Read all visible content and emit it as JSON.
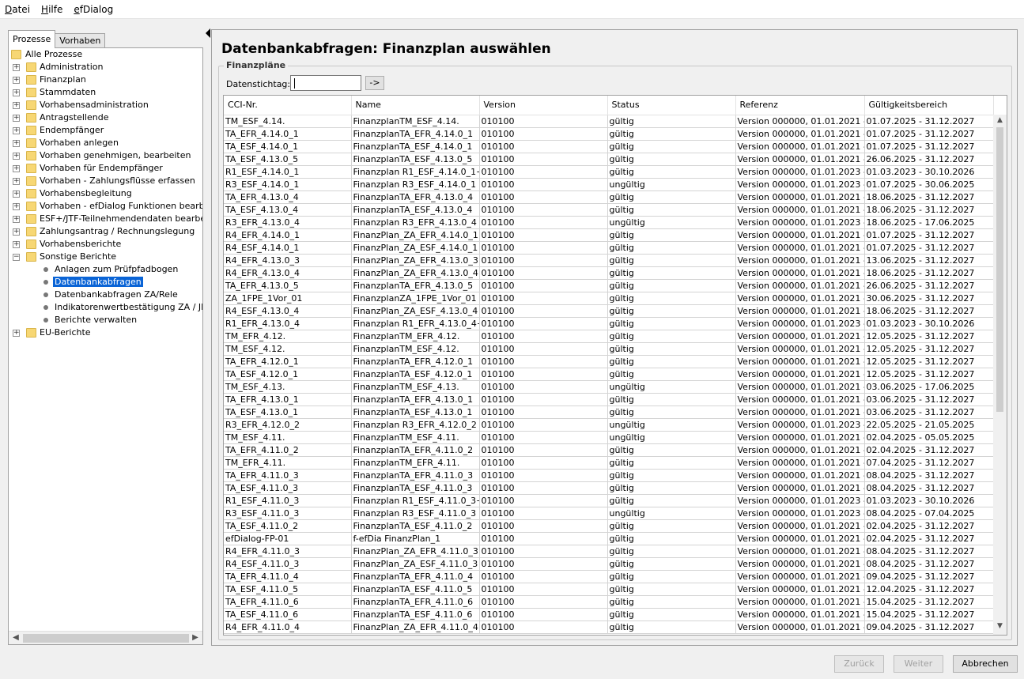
{
  "menu": [
    "Datei",
    "Hilfe",
    "efDialog"
  ],
  "left_tabs": [
    "Prozesse",
    "Vorhaben"
  ],
  "tree": {
    "root": "Alle Prozesse",
    "items": [
      "Administration",
      "Finanzplan",
      "Stammdaten",
      "Vorhabensadministration",
      "Antragstellende",
      "Endempfänger",
      "Vorhaben anlegen",
      "Vorhaben genehmigen, bearbeiten",
      "Vorhaben für Endempfänger",
      "Vorhaben - Zahlungsflüsse erfassen",
      "Vorhabensbegleitung",
      "Vorhaben - efDialog Funktionen bearbeiten",
      "ESF+/JTF-Teilnehmendendaten bearbeiten",
      "Zahlungsantrag / Rechnungslegung",
      "Vorhabensberichte",
      "Sonstige Berichte"
    ],
    "sub_items": [
      "Anlagen zum Prüfpfadbogen",
      "Datenbankabfragen",
      "Datenbankabfragen ZA/Rele",
      "Indikatorenwertbestätigung ZA / JDB",
      "Berichte verwalten"
    ],
    "selected": "Datenbankabfragen",
    "last": "EU-Berichte"
  },
  "main": {
    "title": "Datenbankabfragen: Finanzplan auswählen",
    "group_label": "Finanzpläne",
    "stichtag_label": "Datenstichtag:",
    "stichtag_value": "",
    "go_label": "->",
    "columns": [
      "CCI-Nr.",
      "Name",
      "Version",
      "Status",
      "Referenz",
      "Gültigkeitsbereich"
    ],
    "rows": [
      [
        "TM_ESF_4.14.",
        "FinanzplanTM_ESF_4.14.",
        "010100",
        "gültig",
        "Version 000000,  01.01.2021 -...",
        "01.07.2025 - 31.12.2027"
      ],
      [
        "TA_EFR_4.14.0_1",
        "FinanzplanTA_EFR_4.14.0_1",
        "010100",
        "gültig",
        "Version 000000,  01.01.2021 -...",
        "01.07.2025 - 31.12.2027"
      ],
      [
        "TA_ESF_4.14.0_1",
        "FinanzplanTA_ESF_4.14.0_1",
        "010100",
        "gültig",
        "Version 000000,  01.01.2021 -...",
        "01.07.2025 - 31.12.2027"
      ],
      [
        "TA_ESF_4.13.0_5",
        "FinanzplanTA_ESF_4.13.0_5",
        "010100",
        "gültig",
        "Version 000000,  01.01.2021 -...",
        "26.06.2025 - 31.12.2027"
      ],
      [
        "R1_ESF_4.14.0_1",
        "Finanzplan R1_ESF_4.14.0_1+",
        "010100",
        "gültig",
        "Version 000000,  01.01.2023 -...",
        "01.03.2023 - 30.10.2026"
      ],
      [
        "R3_ESF_4.14.0_1",
        "Finanzplan R3_ESF_4.14.0_1",
        "010100",
        "ungültig",
        "Version 000000,  01.01.2023 -...",
        "01.07.2025 - 30.06.2025"
      ],
      [
        "TA_EFR_4.13.0_4",
        "FinanzplanTA_EFR_4.13.0_4",
        "010100",
        "gültig",
        "Version 000000,  01.01.2021 -...",
        "18.06.2025 - 31.12.2027"
      ],
      [
        "TA_ESF_4.13.0_4",
        "FinanzplanTA_ESF_4.13.0_4",
        "010100",
        "gültig",
        "Version 000000,  01.01.2021 -...",
        "18.06.2025 - 31.12.2027"
      ],
      [
        "R3_EFR_4.13.0_4",
        "Finanzplan R3_EFR_4.13.0_4",
        "010100",
        "ungültig",
        "Version 000000,  01.01.2023 -...",
        "18.06.2025 - 17.06.2025"
      ],
      [
        "R4_EFR_4.14.0_1",
        "FinanzPlan_ZA_EFR_4.14.0_1",
        "010100",
        "gültig",
        "Version 000000,  01.01.2021 -...",
        "01.07.2025 - 31.12.2027"
      ],
      [
        "R4_ESF_4.14.0_1",
        "FinanzPlan_ZA_ESF_4.14.0_1",
        "010100",
        "gültig",
        "Version 000000,  01.01.2021 -...",
        "01.07.2025 - 31.12.2027"
      ],
      [
        "R4_EFR_4.13.0_3",
        "FinanzPlan_ZA_EFR_4.13.0_3",
        "010100",
        "gültig",
        "Version 000000,  01.01.2021 -...",
        "13.06.2025 - 31.12.2027"
      ],
      [
        "R4_EFR_4.13.0_4",
        "FinanzPlan_ZA_EFR_4.13.0_4",
        "010100",
        "gültig",
        "Version 000000,  01.01.2021 -...",
        "18.06.2025 - 31.12.2027"
      ],
      [
        "TA_EFR_4.13.0_5",
        "FinanzplanTA_EFR_4.13.0_5",
        "010100",
        "gültig",
        "Version 000000,  01.01.2021 -...",
        "26.06.2025 - 31.12.2027"
      ],
      [
        "ZA_1FPE_1Vor_01",
        "FinanzplanZA_1FPE_1Vor_01",
        "010100",
        "gültig",
        "Version 000000,  01.01.2021 -...",
        "30.06.2025 - 31.12.2027"
      ],
      [
        "R4_ESF_4.13.0_4",
        "FinanzPlan_ZA_ESF_4.13.0_4",
        "010100",
        "gültig",
        "Version 000000,  01.01.2021 -...",
        "18.06.2025 - 31.12.2027"
      ],
      [
        "R1_EFR_4.13.0_4",
        "Finanzplan R1_EFR_4.13.0_4+",
        "010100",
        "gültig",
        "Version 000000,  01.01.2023 -...",
        "01.03.2023 - 30.10.2026"
      ],
      [
        "TM_EFR_4.12.",
        "FinanzplanTM_EFR_4.12.",
        "010100",
        "gültig",
        "Version 000000,  01.01.2021 -...",
        "12.05.2025 - 31.12.2027"
      ],
      [
        "TM_ESF_4.12.",
        "FinanzplanTM_ESF_4.12.",
        "010100",
        "gültig",
        "Version 000000,  01.01.2021 -...",
        "12.05.2025 - 31.12.2027"
      ],
      [
        "TA_EFR_4.12.0_1",
        "FinanzplanTA_EFR_4.12.0_1",
        "010100",
        "gültig",
        "Version 000000,  01.01.2021 -...",
        "12.05.2025 - 31.12.2027"
      ],
      [
        "TA_ESF_4.12.0_1",
        "FinanzplanTA_ESF_4.12.0_1",
        "010100",
        "gültig",
        "Version 000000,  01.01.2021 -...",
        "12.05.2025 - 31.12.2027"
      ],
      [
        "TM_ESF_4.13.",
        "FinanzplanTM_ESF_4.13.",
        "010100",
        "ungültig",
        "Version 000000,  01.01.2021 -...",
        "03.06.2025 - 17.06.2025"
      ],
      [
        "TA_EFR_4.13.0_1",
        "FinanzplanTA_EFR_4.13.0_1",
        "010100",
        "gültig",
        "Version 000000,  01.01.2021 -...",
        "03.06.2025 - 31.12.2027"
      ],
      [
        "TA_ESF_4.13.0_1",
        "FinanzplanTA_ESF_4.13.0_1",
        "010100",
        "gültig",
        "Version 000000,  01.01.2021 -...",
        "03.06.2025 - 31.12.2027"
      ],
      [
        "R3_EFR_4.12.0_2",
        "Finanzplan R3_EFR_4.12.0_2",
        "010100",
        "ungültig",
        "Version 000000,  01.01.2023 -...",
        "22.05.2025 - 21.05.2025"
      ],
      [
        "TM_ESF_4.11.",
        "FinanzplanTM_ESF_4.11.",
        "010100",
        "ungültig",
        "Version 000000,  01.01.2021 -...",
        "02.04.2025 - 05.05.2025"
      ],
      [
        "TA_EFR_4.11.0_2",
        "FinanzplanTA_EFR_4.11.0_2",
        "010100",
        "gültig",
        "Version 000000,  01.01.2021 -...",
        "02.04.2025 - 31.12.2027"
      ],
      [
        "TM_EFR_4.11.",
        "FinanzplanTM_EFR_4.11.",
        "010100",
        "gültig",
        "Version 000000,  01.01.2021 -...",
        "07.04.2025 - 31.12.2027"
      ],
      [
        "TA_EFR_4.11.0_3",
        "FinanzplanTA_EFR_4.11.0_3",
        "010100",
        "gültig",
        "Version 000000,  01.01.2021 -...",
        "08.04.2025 - 31.12.2027"
      ],
      [
        "TA_ESF_4.11.0_3",
        "FinanzplanTA_ESF_4.11.0_3",
        "010100",
        "gültig",
        "Version 000000,  01.01.2021 -...",
        "08.04.2025 - 31.12.2027"
      ],
      [
        "R1_ESF_4.11.0_3",
        "Finanzplan R1_ESF_4.11.0_3+",
        "010100",
        "gültig",
        "Version 000000,  01.01.2023 -...",
        "01.03.2023 - 30.10.2026"
      ],
      [
        "R3_ESF_4.11.0_3",
        "Finanzplan R3_ESF_4.11.0_3",
        "010100",
        "ungültig",
        "Version 000000,  01.01.2023 -...",
        "08.04.2025 - 07.04.2025"
      ],
      [
        "TA_ESF_4.11.0_2",
        "FinanzplanTA_ESF_4.11.0_2",
        "010100",
        "gültig",
        "Version 000000,  01.01.2021 -...",
        "02.04.2025 - 31.12.2027"
      ],
      [
        "efDialog-FP-01",
        "f-efDia FinanzPlan_1",
        "010100",
        "gültig",
        "Version 000000,  01.01.2021 -...",
        "02.04.2025 - 31.12.2027"
      ],
      [
        "R4_EFR_4.11.0_3",
        "FinanzPlan_ZA_EFR_4.11.0_3",
        "010100",
        "gültig",
        "Version 000000,  01.01.2021 -...",
        "08.04.2025 - 31.12.2027"
      ],
      [
        "R4_ESF_4.11.0_3",
        "FinanzPlan_ZA_ESF_4.11.0_3",
        "010100",
        "gültig",
        "Version 000000,  01.01.2021 -...",
        "08.04.2025 - 31.12.2027"
      ],
      [
        "TA_EFR_4.11.0_4",
        "FinanzplanTA_EFR_4.11.0_4",
        "010100",
        "gültig",
        "Version 000000,  01.01.2021 -...",
        "09.04.2025 - 31.12.2027"
      ],
      [
        "TA_ESF_4.11.0_5",
        "FinanzplanTA_ESF_4.11.0_5",
        "010100",
        "gültig",
        "Version 000000,  01.01.2021 -...",
        "12.04.2025 - 31.12.2027"
      ],
      [
        "TA_EFR_4.11.0_6",
        "FinanzplanTA_EFR_4.11.0_6",
        "010100",
        "gültig",
        "Version 000000,  01.01.2021 -...",
        "15.04.2025 - 31.12.2027"
      ],
      [
        "TA_ESF_4.11.0_6",
        "FinanzplanTA_ESF_4.11.0_6",
        "010100",
        "gültig",
        "Version 000000,  01.01.2021 -...",
        "15.04.2025 - 31.12.2027"
      ],
      [
        "R4_EFR_4.11.0_4",
        "FinanzPlan_ZA_EFR_4.11.0_4",
        "010100",
        "gültig",
        "Version 000000,  01.01.2021 -...",
        "09.04.2025 - 31.12.2027"
      ]
    ]
  },
  "buttons": {
    "back": "Zurück",
    "next": "Weiter",
    "cancel": "Abbrechen"
  },
  "colors": {
    "selection": "#0a64d6",
    "folder": "#f7d774"
  }
}
